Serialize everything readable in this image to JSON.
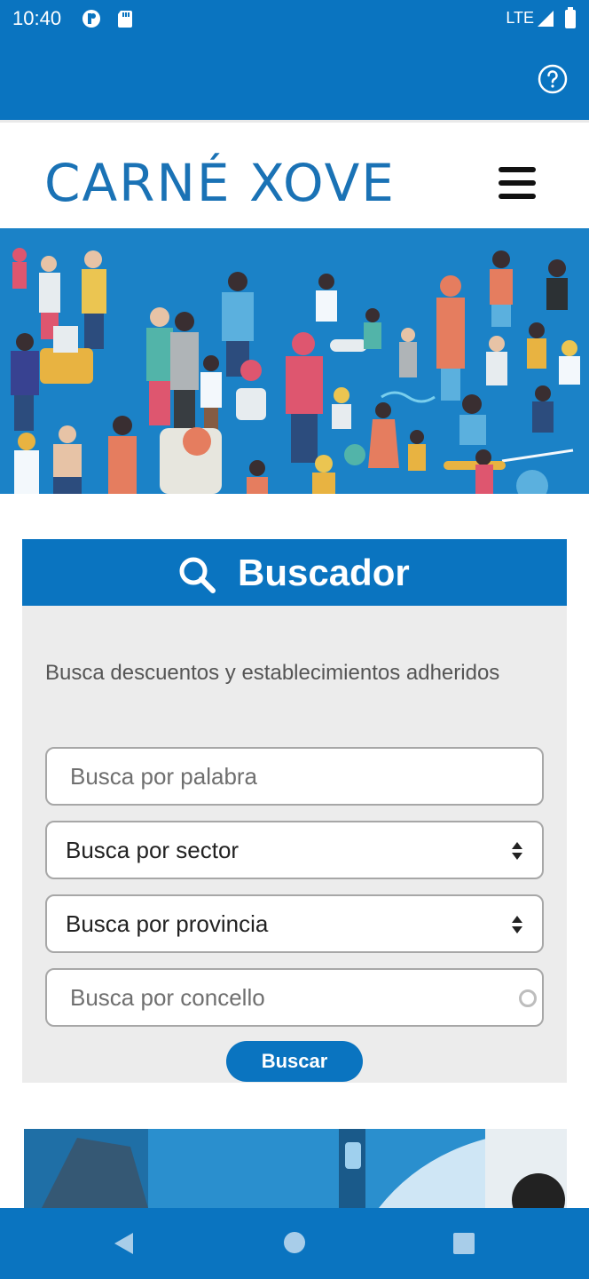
{
  "status": {
    "time": "10:40",
    "network": "LTE"
  },
  "header": {
    "logo": "CARNÉ XOVE"
  },
  "search": {
    "title": "Buscador",
    "description": "Busca descuentos y establecimientos adheridos",
    "keyword_placeholder": "Busca por palabra",
    "sector_select": "Busca por sector",
    "province_select": "Busca por provincia",
    "council_placeholder": "Busca por concello",
    "button_label": "Buscar"
  },
  "colors": {
    "primary": "#0a74c0",
    "logo": "#1a72b5",
    "card_bg": "#ececec"
  },
  "icons": {
    "help": "help-circle-icon",
    "menu": "hamburger-menu-icon",
    "search": "magnifier-icon",
    "nav_back": "triangle-back-icon",
    "nav_home": "circle-home-icon",
    "nav_recent": "square-recents-icon"
  }
}
